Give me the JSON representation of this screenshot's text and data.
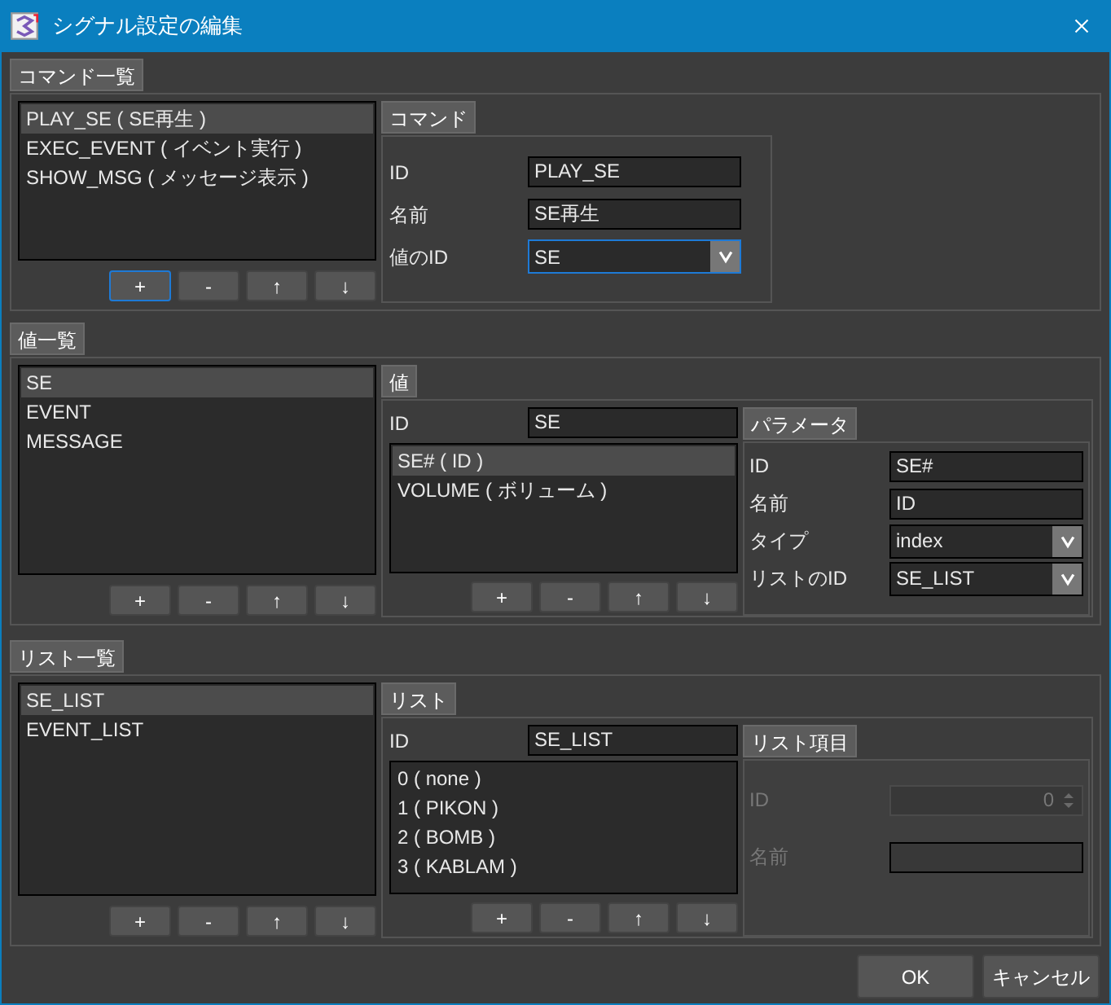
{
  "window": {
    "title": "シグナル設定の編集"
  },
  "command_section": {
    "title": "コマンド一覧",
    "list": [
      {
        "label": "PLAY_SE ( SE再生 )",
        "selected": true
      },
      {
        "label": "EXEC_EVENT ( イベント実行 )",
        "selected": false
      },
      {
        "label": "SHOW_MSG ( メッセージ表示 )",
        "selected": false
      }
    ],
    "buttons": [
      {
        "label": "+",
        "focused": true
      },
      {
        "label": "-",
        "focused": false
      },
      {
        "label": "↑",
        "focused": false
      },
      {
        "label": "↓",
        "focused": false
      }
    ],
    "detail": {
      "title": "コマンド",
      "fields": [
        {
          "kind": "text",
          "label": "ID",
          "value": "PLAY_SE"
        },
        {
          "kind": "text",
          "label": "名前",
          "value": "SE再生"
        },
        {
          "kind": "select",
          "label": "値のID",
          "value": "SE",
          "focused": true
        }
      ]
    }
  },
  "value_section": {
    "title": "値一覧",
    "list": [
      {
        "label": "SE",
        "selected": true
      },
      {
        "label": "EVENT",
        "selected": false
      },
      {
        "label": "MESSAGE",
        "selected": false
      }
    ],
    "buttons": [
      {
        "label": "+",
        "focused": false
      },
      {
        "label": "-",
        "focused": false
      },
      {
        "label": "↑",
        "focused": false
      },
      {
        "label": "↓",
        "focused": false
      }
    ],
    "detail": {
      "title": "値",
      "id_label": "ID",
      "id_value": "SE",
      "list": [
        {
          "label": "SE# ( ID )",
          "selected": true
        },
        {
          "label": "VOLUME ( ボリューム )",
          "selected": false
        }
      ],
      "buttons": [
        {
          "label": "+",
          "focused": false
        },
        {
          "label": "-",
          "focused": false
        },
        {
          "label": "↑",
          "focused": false
        },
        {
          "label": "↓",
          "focused": false
        }
      ],
      "sub": {
        "title": "パラメータ",
        "disabled": false,
        "fields": [
          {
            "kind": "text",
            "label": "ID",
            "value": "SE#"
          },
          {
            "kind": "text",
            "label": "名前",
            "value": "ID"
          },
          {
            "kind": "select",
            "label": "タイプ",
            "value": "index",
            "focused": false
          },
          {
            "kind": "select",
            "label": "リストのID",
            "value": "SE_LIST",
            "focused": false
          }
        ]
      }
    }
  },
  "list_section": {
    "title": "リスト一覧",
    "list": [
      {
        "label": "SE_LIST",
        "selected": true
      },
      {
        "label": "EVENT_LIST",
        "selected": false
      }
    ],
    "buttons": [
      {
        "label": "+",
        "focused": false
      },
      {
        "label": "-",
        "focused": false
      },
      {
        "label": "↑",
        "focused": false
      },
      {
        "label": "↓",
        "focused": false
      }
    ],
    "detail": {
      "title": "リスト",
      "id_label": "ID",
      "id_value": "SE_LIST",
      "list": [
        {
          "label": "0 ( none )",
          "selected": false
        },
        {
          "label": "1 ( PIKON )",
          "selected": false
        },
        {
          "label": "2 ( BOMB )",
          "selected": false
        },
        {
          "label": "3 ( KABLAM )",
          "selected": false
        }
      ],
      "buttons": [
        {
          "label": "+",
          "focused": false
        },
        {
          "label": "-",
          "focused": false
        },
        {
          "label": "↑",
          "focused": false
        },
        {
          "label": "↓",
          "focused": false
        }
      ],
      "sub": {
        "title": "リスト項目",
        "disabled": true,
        "fields": [
          {
            "kind": "spin",
            "label": "ID",
            "value": "0"
          },
          {
            "kind": "text",
            "label": "名前"
          }
        ]
      }
    }
  },
  "footer": {
    "buttons": [
      "OK",
      "キャンセル"
    ]
  }
}
